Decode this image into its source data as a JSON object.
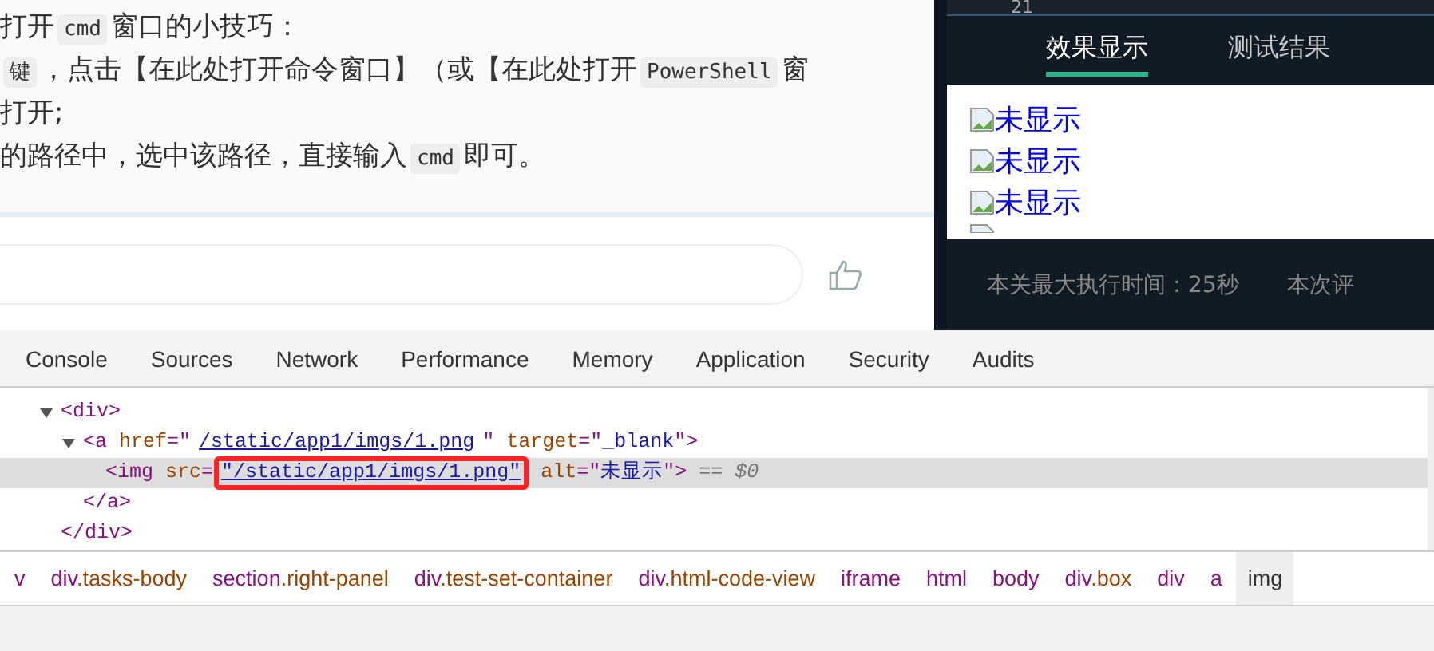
{
  "article": {
    "lines": [
      [
        {
          "kind": "text",
          "text": "打开"
        },
        {
          "kind": "code",
          "text": "cmd"
        },
        {
          "kind": "text",
          "text": "窗口的小技巧："
        }
      ],
      [
        {
          "kind": "code",
          "text": "键"
        },
        {
          "kind": "text",
          "text": "，点击【在此处打开命令窗口】（或【在此处打开"
        },
        {
          "kind": "code",
          "text": "PowerShell"
        },
        {
          "kind": "text",
          "text": "窗"
        }
      ],
      [
        {
          "kind": "text",
          "text": "打开;"
        }
      ],
      [
        {
          "kind": "text",
          "text": "的路径中，选中该路径，直接输入"
        },
        {
          "kind": "code",
          "text": "cmd"
        },
        {
          "kind": "text",
          "text": "即可。"
        }
      ]
    ]
  },
  "preview_panel": {
    "line_number": "21",
    "tabs": [
      {
        "label": "效果显示",
        "selected": true
      },
      {
        "label": "测试结果",
        "selected": false
      }
    ],
    "images": [
      {
        "alt": "未显示"
      },
      {
        "alt": "未显示"
      },
      {
        "alt": "未显示"
      }
    ],
    "footer": [
      "本关最大执行时间：25秒",
      "本次评"
    ]
  },
  "devtools": {
    "tabs": [
      {
        "label": "Console"
      },
      {
        "label": "Sources"
      },
      {
        "label": "Network"
      },
      {
        "label": "Performance"
      },
      {
        "label": "Memory"
      },
      {
        "label": "Application"
      },
      {
        "label": "Security"
      },
      {
        "label": "Audits"
      }
    ],
    "tree": [
      {
        "expanded": true,
        "selected": false,
        "open": [
          {
            "kind": "tag",
            "text": "<div>"
          }
        ],
        "close": [
          {
            "kind": "tag",
            "text": "</div>"
          }
        ],
        "children": [
          {
            "expanded": true,
            "selected": false,
            "open": [
              {
                "kind": "tag",
                "text": "<a"
              },
              {
                "kind": "attr",
                "text": "href"
              },
              {
                "kind": "punct",
                "text": "=\""
              },
              {
                "kind": "link",
                "text": "/static/app1/imgs/1.png",
                "highlighted": false
              },
              {
                "kind": "punct",
                "text": "\""
              },
              {
                "kind": "attr",
                "text": "target"
              },
              {
                "kind": "punct",
                "text": "=\""
              },
              {
                "kind": "value",
                "text": "_blank"
              },
              {
                "kind": "punct",
                "text": "\">"
              }
            ],
            "close": [
              {
                "kind": "tag",
                "text": "</a>"
              }
            ],
            "children": [
              {
                "selected": true,
                "open": [
                  {
                    "kind": "tag",
                    "text": "<img"
                  },
                  {
                    "kind": "attr",
                    "text": "src"
                  },
                  {
                    "kind": "punct",
                    "text": "="
                  },
                  {
                    "kind": "link",
                    "text": "\"/static/app1/imgs/1.png\"",
                    "highlighted": true
                  },
                  {
                    "kind": "attr",
                    "text": "alt"
                  },
                  {
                    "kind": "punct",
                    "text": "=\""
                  },
                  {
                    "kind": "value",
                    "text": "未显示"
                  },
                  {
                    "kind": "punct",
                    "text": "\">"
                  },
                  {
                    "kind": "note",
                    "text": "== $0"
                  }
                ]
              }
            ]
          }
        ]
      }
    ],
    "breadcrumbs": [
      {
        "tag": "v",
        "selected": false
      },
      {
        "tag": "div",
        "cls": ".tasks-body",
        "selected": false
      },
      {
        "tag": "section",
        "cls": ".right-panel",
        "selected": false
      },
      {
        "tag": "div",
        "cls": ".test-set-container",
        "selected": false
      },
      {
        "tag": "div",
        "cls": ".html-code-view",
        "selected": false
      },
      {
        "tag": "iframe",
        "selected": false
      },
      {
        "tag": "html",
        "selected": false
      },
      {
        "tag": "body",
        "selected": false
      },
      {
        "tag": "div",
        "cls": ".box",
        "selected": false
      },
      {
        "tag": "div",
        "selected": false
      },
      {
        "tag": "a",
        "selected": false
      },
      {
        "tag": "img",
        "selected": true
      }
    ]
  }
}
